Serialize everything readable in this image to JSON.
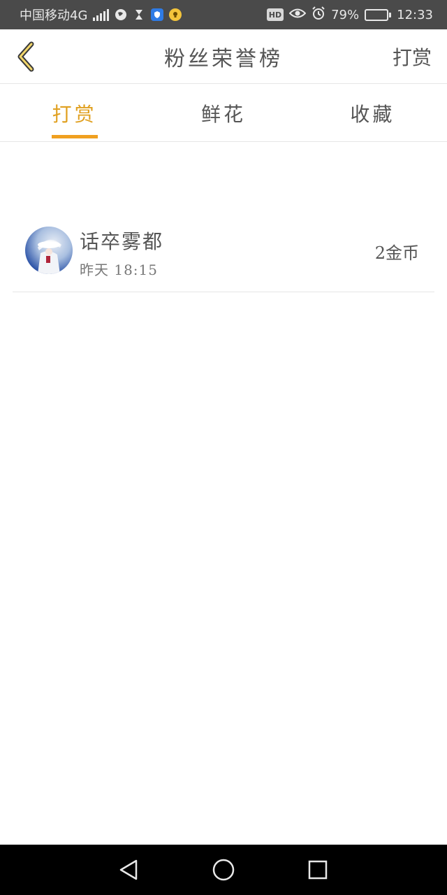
{
  "status_bar": {
    "carrier": "中国移动4G",
    "network_badge": "4G",
    "battery_percent": "79%",
    "battery_level": 0.79,
    "time": "12:33",
    "hd_label": "HD",
    "icons": [
      "signal-icon",
      "globe-icon",
      "hourglass-icon",
      "shield-icon",
      "bulb-icon",
      "eye-icon",
      "alarm-icon",
      "battery-icon"
    ]
  },
  "header": {
    "title": "粉丝荣誉榜",
    "action_label": "打赏",
    "back_icon": "chevron-left-icon"
  },
  "tabs": [
    {
      "label": "打赏",
      "active": true
    },
    {
      "label": "鲜花",
      "active": false
    },
    {
      "label": "收藏",
      "active": false
    }
  ],
  "list": [
    {
      "name": "话卒雾都",
      "time": "昨天 18:15",
      "amount": "2金币"
    }
  ],
  "colors": {
    "accent": "#f0a020",
    "text": "#555555",
    "status_bar_bg": "#4a4a4a",
    "nav_bar_bg": "#000000"
  },
  "nav_bar": {
    "icons": [
      "back-triangle-icon",
      "home-circle-icon",
      "recent-square-icon"
    ]
  }
}
